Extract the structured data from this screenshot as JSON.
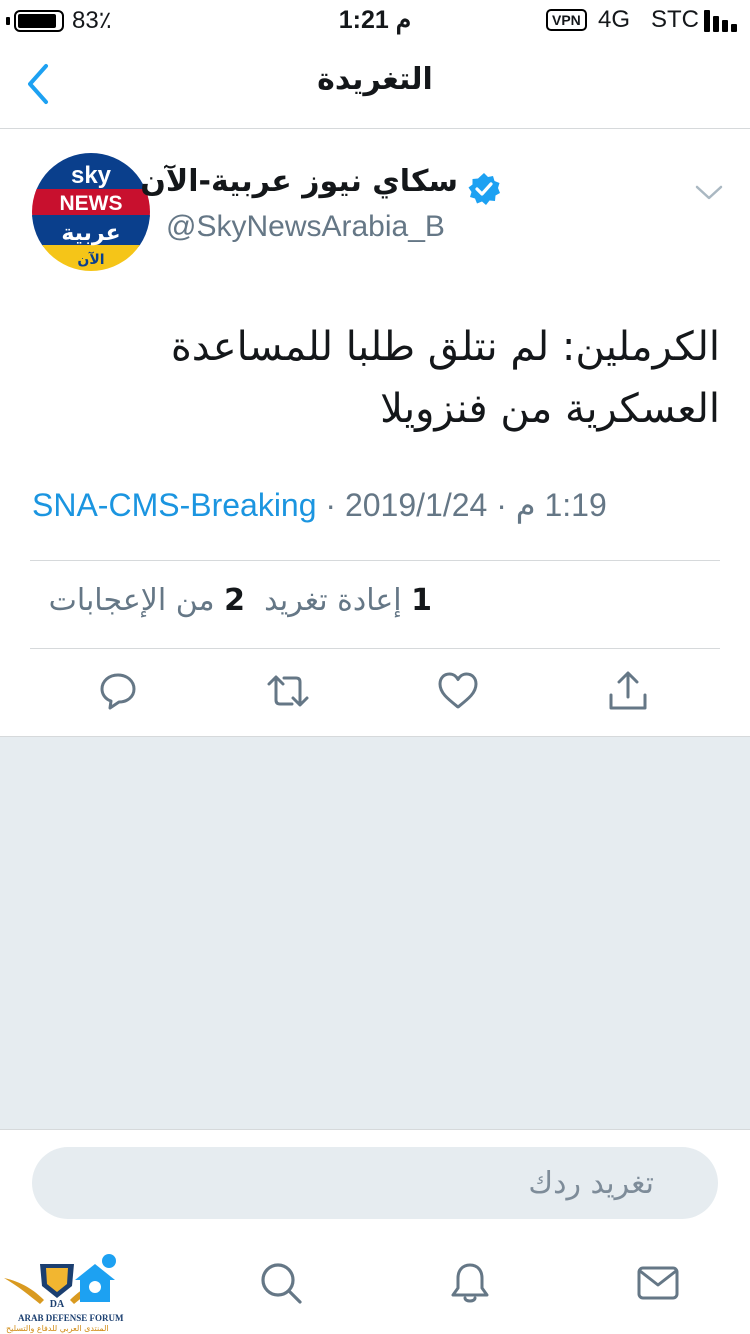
{
  "status_bar": {
    "battery_percent": "83٪",
    "battery_level": 0.83,
    "time": "1:21 م",
    "vpn": "VPN",
    "network": "4G",
    "carrier": "STC"
  },
  "nav": {
    "title": "التغريدة",
    "back_icon": "chevron-left-icon"
  },
  "tweet": {
    "author_name": "سكاي نيوز عربية-الآن",
    "handle": "@SkyNewsArabia_B",
    "verified": true,
    "avatar": {
      "line1": "sky",
      "line2": "NEWS",
      "line3": "عربية",
      "line4": "الآن"
    },
    "text": "الكرملين: لم نتلق طلبا للمساعدة العسكرية من فنزويلا",
    "time": "1:19 م",
    "date": "2019/1/24",
    "source": "SNA-CMS-Breaking",
    "separator": " · ",
    "likes_count": "2",
    "likes_label": "من الإعجابات",
    "retweets_count": "1",
    "retweets_label": "إعادة تغريد"
  },
  "actions": [
    "reply-icon",
    "retweet-icon",
    "like-icon",
    "share-icon"
  ],
  "reply_box": {
    "placeholder": "تغريد ردك"
  },
  "tab_bar": [
    "home-icon",
    "search-icon",
    "notifications-icon",
    "messages-icon"
  ],
  "watermark": {
    "badge": "DA",
    "line1": "ARAB DEFENSE FORUM",
    "line2": "المنتدى العربي للدفاع والتسليح"
  },
  "colors": {
    "accent": "#1da1f2",
    "link": "#1b95e0",
    "secondary_text": "#657786",
    "background_empty": "#e6ecf0"
  }
}
